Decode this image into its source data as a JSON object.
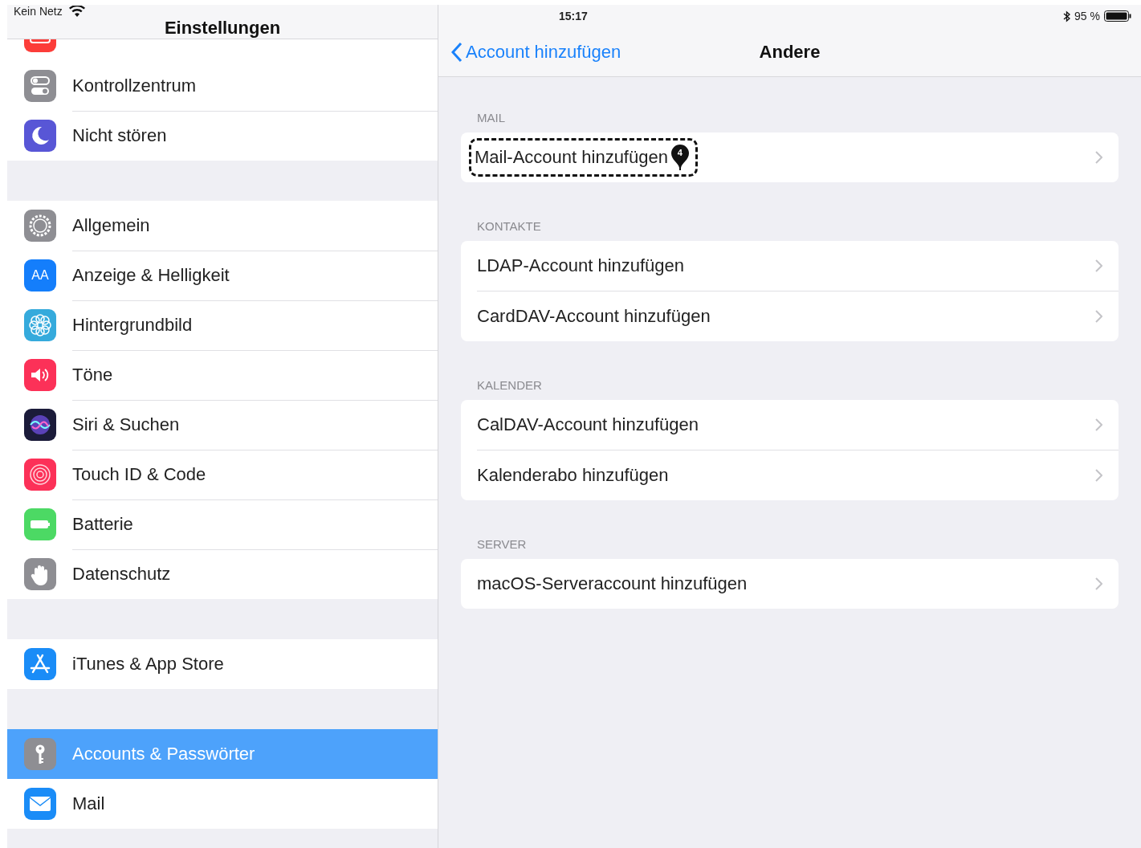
{
  "status_bar": {
    "carrier": "Kein Netz",
    "time": "15:17",
    "battery": "95 %"
  },
  "sidebar": {
    "title": "Einstellungen",
    "groups": [
      {
        "items": [
          {
            "kind": "notifications",
            "selected": false
          },
          {
            "kind": "control",
            "label": "Kontrollzentrum",
            "selected": false
          },
          {
            "kind": "moon",
            "label": "Nicht stören",
            "selected": false
          }
        ]
      },
      {
        "items": [
          {
            "kind": "gear",
            "label": "Allgemein",
            "selected": false
          },
          {
            "kind": "display",
            "icon_text": "AA",
            "label": "Anzeige & Helligkeit",
            "selected": false
          },
          {
            "kind": "wallpaper",
            "label": "Hintergrundbild",
            "selected": false
          },
          {
            "kind": "sounds",
            "label": "Töne",
            "selected": false
          },
          {
            "kind": "siri",
            "label": "Siri & Suchen",
            "selected": false
          },
          {
            "kind": "touchid",
            "label": "Touch ID & Code",
            "selected": false
          },
          {
            "kind": "battery",
            "label": "Batterie",
            "selected": false
          },
          {
            "kind": "privacy",
            "label": "Datenschutz",
            "selected": false
          }
        ]
      },
      {
        "items": [
          {
            "kind": "appstore",
            "label": "iTunes & App Store",
            "selected": false
          }
        ]
      },
      {
        "items": [
          {
            "kind": "key",
            "label": "Accounts & Passwörter",
            "selected": true
          },
          {
            "kind": "mail",
            "label": "Mail",
            "selected": false
          }
        ]
      }
    ]
  },
  "detail": {
    "back_label": "Account hinzufügen",
    "title": "Andere",
    "sections": [
      {
        "header": "MAIL",
        "rows": [
          {
            "label": "Mail-Account hinzufügen",
            "marker": "4"
          }
        ]
      },
      {
        "header": "KONTAKTE",
        "rows": [
          {
            "label": "LDAP-Account hinzufügen"
          },
          {
            "label": "CardDAV-Account hinzufügen"
          }
        ]
      },
      {
        "header": "KALENDER",
        "rows": [
          {
            "label": "CalDAV-Account hinzufügen"
          },
          {
            "label": "Kalenderabo hinzufügen"
          }
        ]
      },
      {
        "header": "SERVER",
        "rows": [
          {
            "label": "macOS-Serveraccount hinzufügen"
          }
        ]
      }
    ]
  }
}
